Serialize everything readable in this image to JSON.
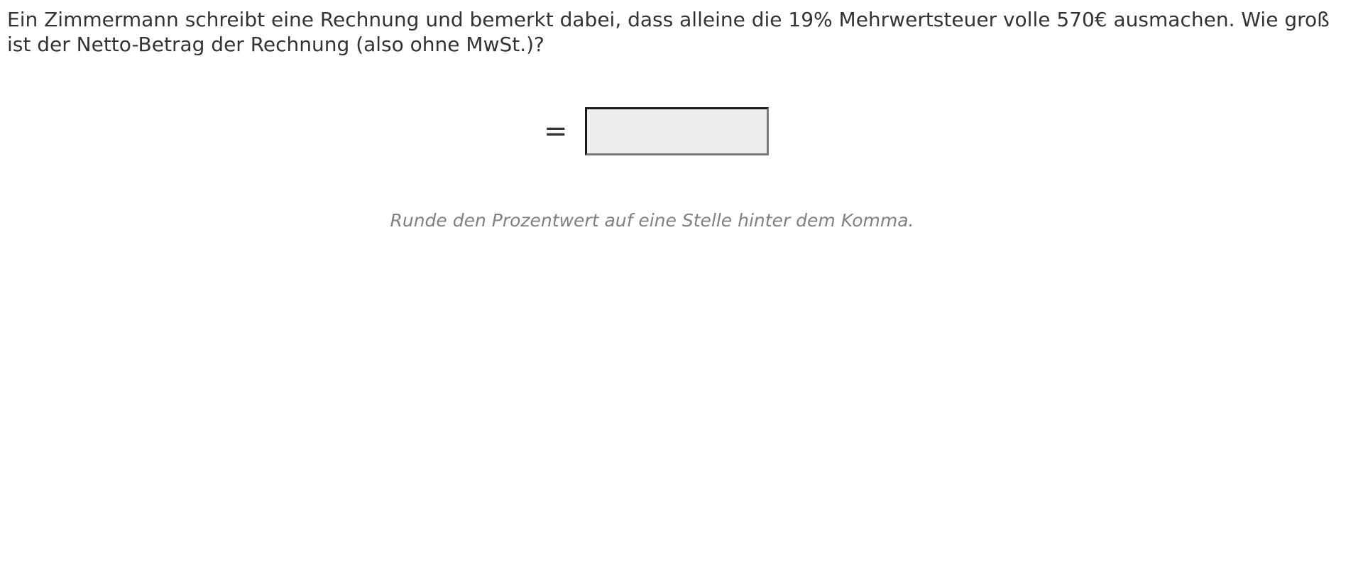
{
  "exercise": {
    "question": "Ein Zimmermann schreibt eine Rechnung und bemerkt dabei, dass alleine die 19% Mehrwertsteuer volle 570€ ausmachen. Wie groß ist der Netto-Betrag der Rechnung (also ohne MwSt.)?",
    "equals_sign": "=",
    "answer_value": "",
    "hint": "Runde den Prozentwert auf eine Stelle hinter dem Komma."
  },
  "colors": {
    "text": "#333333",
    "hint": "#808080",
    "input_background": "#eeeeee",
    "input_border_dark": "#1a1a1a",
    "input_border_light": "#7a7a7a"
  }
}
